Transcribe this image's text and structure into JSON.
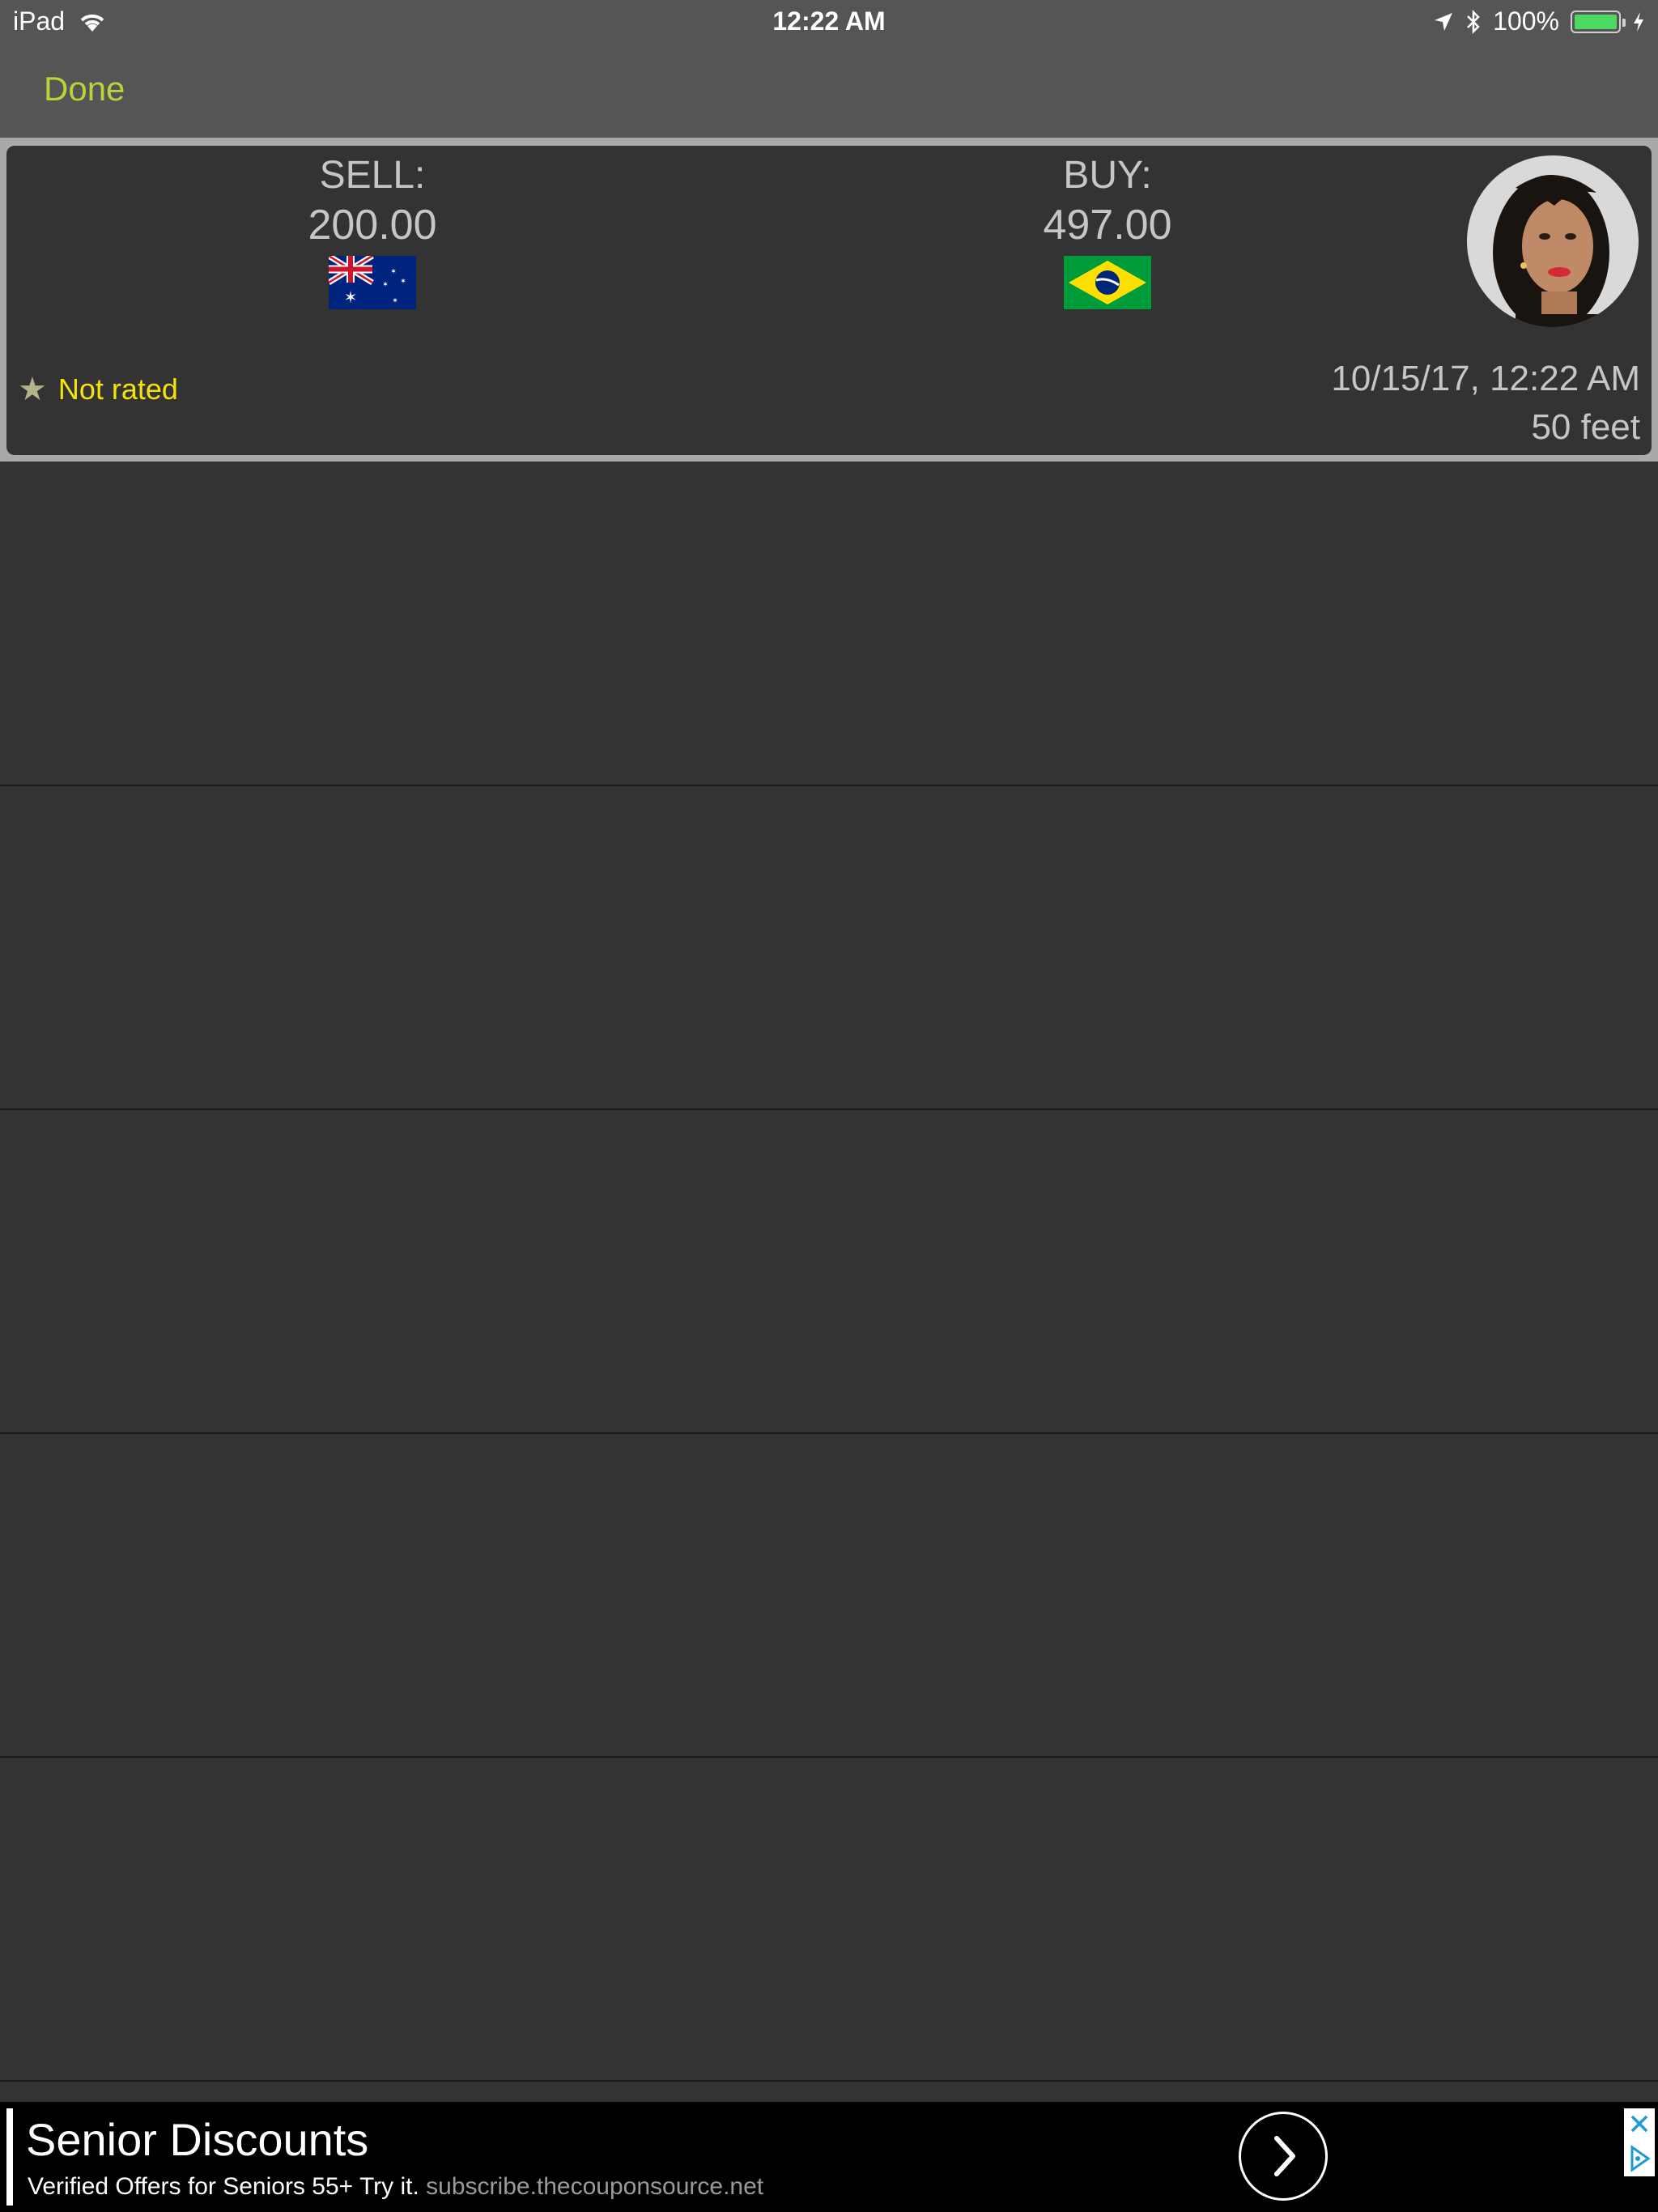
{
  "status_bar": {
    "device": "iPad",
    "time": "12:22 AM",
    "battery": "100%"
  },
  "nav": {
    "done_label": "Done"
  },
  "trade": {
    "sell_label": "SELL:",
    "sell_amount": "200.00",
    "sell_flag": "australia-flag-icon",
    "buy_label": "BUY:",
    "buy_amount": "497.00",
    "buy_flag": "brazil-flag-icon",
    "rating_text": "Not rated",
    "datetime": "10/15/17, 12:22 AM",
    "distance": "50 feet"
  },
  "ad": {
    "title": "Senior Discounts",
    "subtitle": "Verified Offers for Seniors 55+ Try it.",
    "url": "subscribe.thecouponsource.net"
  },
  "colors": {
    "accent": "#b6d43c",
    "rating": "#f2e30c",
    "background": "#333333",
    "bar": "#555555"
  }
}
